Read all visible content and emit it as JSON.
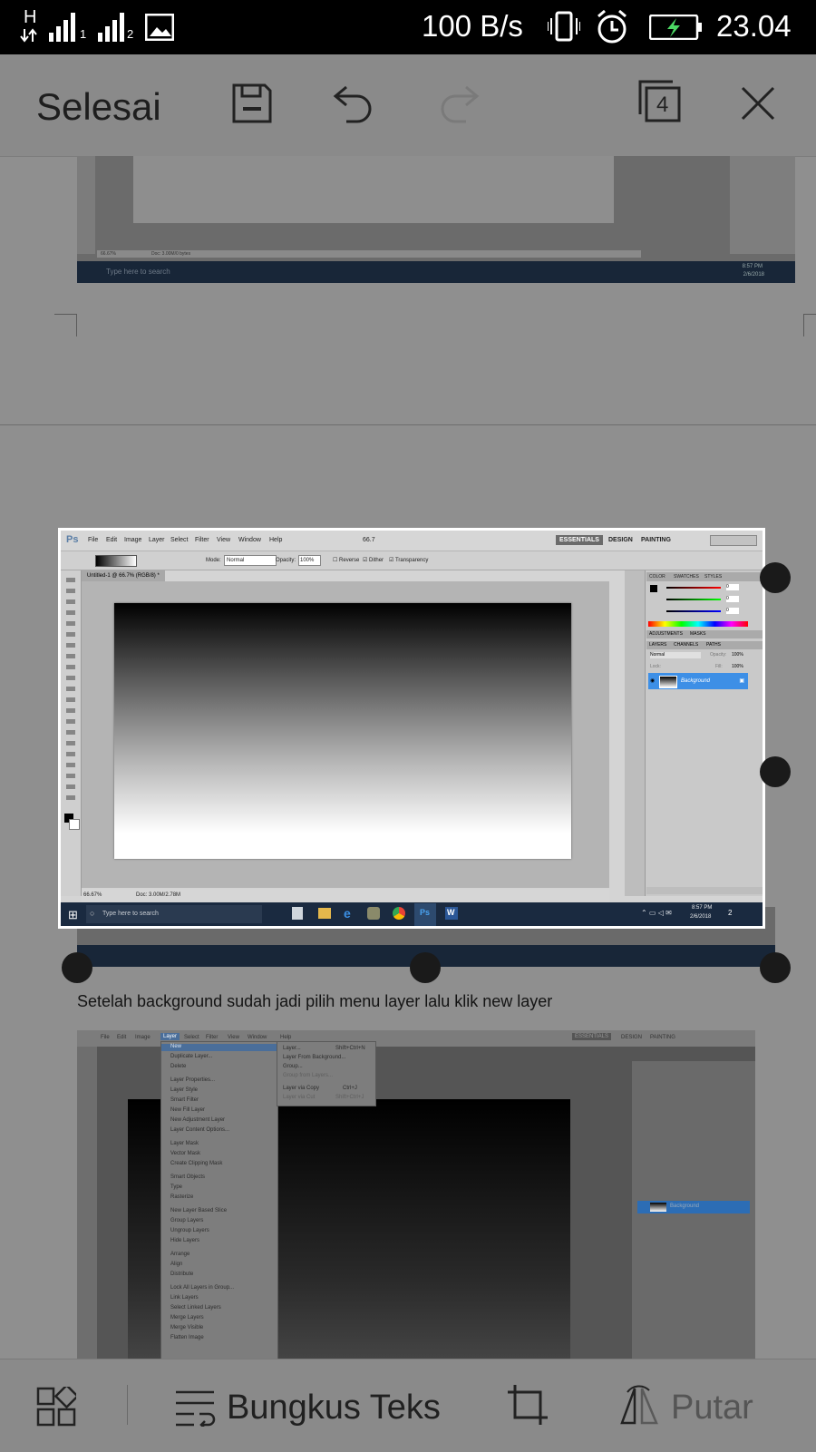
{
  "status_bar": {
    "network_type": "H",
    "sim1_label": "1",
    "sim2_label": "2",
    "speed": "100 B/s",
    "time": "23.04",
    "colors": {
      "background": "#000000",
      "battery_bolt": "#4cd964"
    }
  },
  "toolbar": {
    "done_label": "Selesai",
    "page_count": "4",
    "icons": [
      "save-icon",
      "undo-icon",
      "redo-icon",
      "pages-icon",
      "close-icon"
    ]
  },
  "top_screenshot": {
    "zoom": "66.67%",
    "doc": "Doc: 3.00M/0 bytes",
    "search_placeholder": "Type here to search",
    "clock_time": "8:57 PM",
    "clock_date": "2/6/2018"
  },
  "main_screenshot": {
    "menu": [
      "File",
      "Edit",
      "Image",
      "Layer",
      "Select",
      "Filter",
      "View",
      "Window",
      "Help"
    ],
    "zoom_menu": "66.7",
    "workspaces": [
      "ESSENTIALS",
      "DESIGN",
      "PAINTING"
    ],
    "options": {
      "mode_label": "Mode:",
      "mode_value": "Normal",
      "opacity_label": "Opacity:",
      "opacity_value": "100%",
      "reverse": "Reverse",
      "dither": "Dither",
      "transparency": "Transparency"
    },
    "tab": "Untitled-1 @ 66.7% (RGB/8) *",
    "panel_tabs_color": [
      "COLOR",
      "SWATCHES",
      "STYLES"
    ],
    "panel_tabs_adj": [
      "ADJUSTMENTS",
      "MASKS"
    ],
    "panel_tabs_layers": [
      "LAYERS",
      "CHANNELS",
      "PATHS"
    ],
    "layer_mode": "Normal",
    "opacity_short": "Opacity:",
    "opacity_pct": "100%",
    "lock_label": "Lock:",
    "fill_label": "Fill:",
    "fill_pct": "100%",
    "rgb_values": [
      "0",
      "0",
      "0"
    ],
    "layer_name": "Background",
    "status_zoom": "66.67%",
    "status_doc": "Doc: 3.00M/2.78M",
    "search_placeholder": "Type here to search",
    "clock_time": "8:57 PM",
    "clock_date": "2/6/2018",
    "notif_count": "2"
  },
  "caption": "Setelah background sudah jadi pilih menu layer lalu klik new layer",
  "bottom_screenshot": {
    "menu": [
      "File",
      "Edit",
      "Image",
      "Layer",
      "Select",
      "Filter",
      "View",
      "Window",
      "Help"
    ],
    "workspace": "ESSENTIALS",
    "design": "DESIGN",
    "painting": "PAINTING",
    "layer_menu": [
      "New",
      "Duplicate Layer...",
      "Delete",
      "Layer Properties...",
      "Layer Style",
      "Smart Filter",
      "New Fill Layer",
      "New Adjustment Layer",
      "Layer Content Options...",
      "Layer Mask",
      "Vector Mask",
      "Create Clipping Mask",
      "Smart Objects",
      "Type",
      "Rasterize",
      "New Layer Based Slice",
      "Group Layers",
      "Ungroup Layers",
      "Hide Layers",
      "Arrange",
      "Align",
      "Distribute",
      "Lock All Layers in Group...",
      "Link Layers",
      "Select Linked Layers",
      "Merge Layers",
      "Merge Visible",
      "Flatten Image"
    ],
    "new_submenu": [
      "Layer...",
      "Layer From Background...",
      "Group...",
      "Group from Layers...",
      "Layer via Copy",
      "Layer via Cut"
    ],
    "shortcuts": [
      "Shift+Ctrl+N",
      "Ctrl+J",
      "Shift+Ctrl+J"
    ],
    "layer_name": "Background"
  },
  "bottom_bar": {
    "wrap_label": "Bungkus Teks",
    "rotate_label": "Putar",
    "icons": [
      "layout-icon",
      "wrap-text-icon",
      "crop-icon",
      "rotate-icon"
    ]
  }
}
